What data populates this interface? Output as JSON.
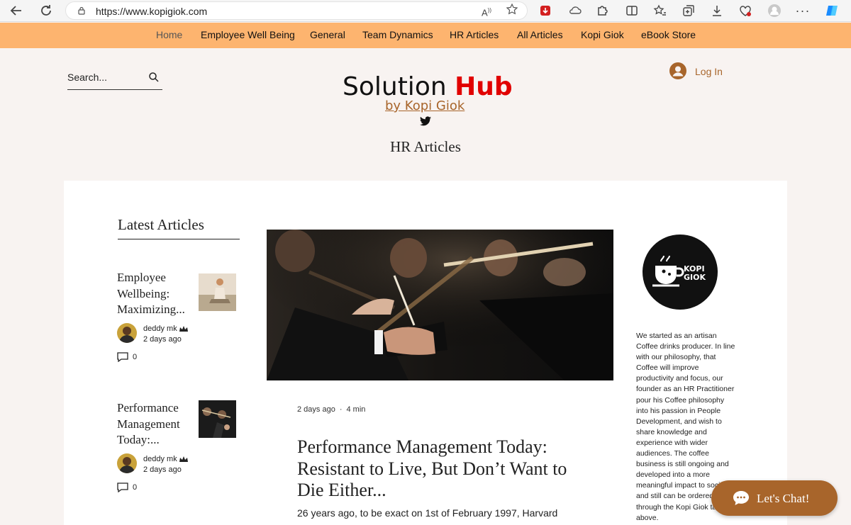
{
  "browser": {
    "url": "https://www.kopigiok.com",
    "read_aloud_label": "A",
    "read_aloud_super": "))"
  },
  "nav": {
    "items": [
      {
        "label": "Home",
        "active": true
      },
      {
        "label": "Employee Well Being",
        "active": false
      },
      {
        "label": "General",
        "active": false
      },
      {
        "label": "Team Dynamics",
        "active": false
      },
      {
        "label": "HR Articles",
        "active": false
      },
      {
        "label": "All Articles",
        "active": false
      },
      {
        "label": "Kopi Giok",
        "active": false
      },
      {
        "label": "eBook Store",
        "active": false
      }
    ]
  },
  "header": {
    "search_placeholder": "Search...",
    "logo_main": "Solution ",
    "logo_accent": "Hub",
    "logo_sub": "by Kopi Giok",
    "login_label": "Log In",
    "page_heading": "HR Articles"
  },
  "sidebar": {
    "title": "Latest Articles",
    "cards": [
      {
        "title": "Employee Wellbeing: Maximizing...",
        "author": "deddy mk",
        "date": "2 days ago",
        "comments": "0"
      },
      {
        "title": "Performance Management Today:...",
        "author": "deddy mk",
        "date": "2 days ago",
        "comments": "0"
      }
    ]
  },
  "post": {
    "date": "2 days ago",
    "separator": "·",
    "read_time": "4 min",
    "title": "Performance Management Today: Resistant to Live, But Don’t Want to Die Either...",
    "excerpt": "26 years ago, to be exact on 1st of February 1997, Harvard"
  },
  "aside": {
    "logo_line1": "KOPI",
    "logo_line2": "GIOK",
    "about": "We started as an artisan Coffee drinks producer. In line with our philosophy, that Coffee will improve productivity and focus, our founder as an HR Practitioner pour his Coffee philosophy into his passion in People Development, and wish to share knowledge and experience with wider audiences. The coffee business is still ongoing and developed into a more meaningful impact to society, and still can be ordered through the Kopi Giok tab above."
  },
  "chat": {
    "label": "Let's Chat!"
  },
  "colors": {
    "nav_bg": "#fdb46f",
    "accent_brown": "#a8652b",
    "hub_red": "#e10000",
    "page_bg": "#f8f3f1"
  }
}
